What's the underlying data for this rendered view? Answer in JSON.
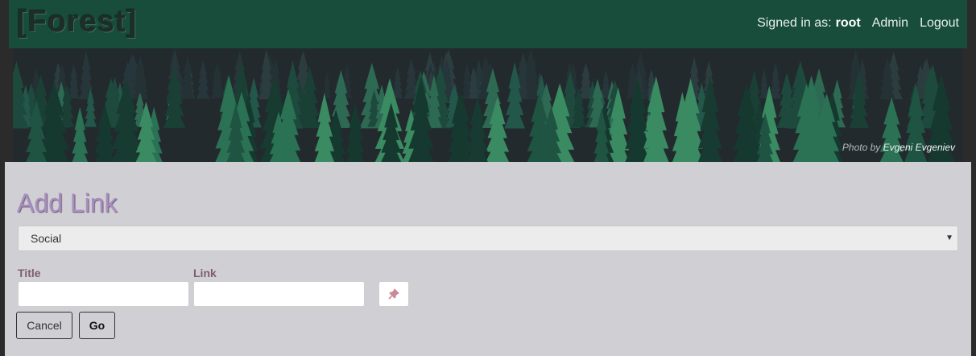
{
  "header": {
    "brand": "[Forest]",
    "signed_in_label": "Signed in as:",
    "username": "root",
    "admin_link": "Admin",
    "logout_link": "Logout"
  },
  "banner": {
    "credit_prefix": "Photo by",
    "credit_author": "Evgeni Evgeniev"
  },
  "form": {
    "title": "Add Link",
    "category_select": {
      "selected": "Social"
    },
    "title_label": "Title",
    "title_value": "",
    "link_label": "Link",
    "link_value": "",
    "pin_icon": "pin-icon",
    "cancel_label": "Cancel",
    "go_label": "Go"
  },
  "colors": {
    "navbar": "#174d3a",
    "panel": "#d0cfd4",
    "title_accent": "#a98fbf",
    "label_color": "#7e5d6d"
  }
}
